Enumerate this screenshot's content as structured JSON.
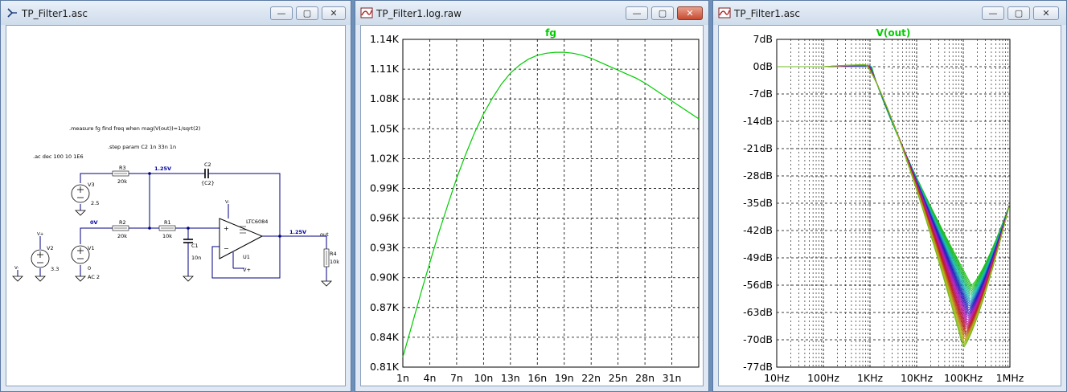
{
  "windows": {
    "schematic": {
      "title": "TP_Filter1.asc",
      "directives": [
        ".measure fg find freq when mag(V(out))=1/sqrt(2)",
        ".step param C2 1n 33n 1n",
        ".ac dec 100 10 1E6"
      ],
      "components": {
        "R3": {
          "name": "R3",
          "value": "20k"
        },
        "R2": {
          "name": "R2",
          "value": "20k"
        },
        "R1": {
          "name": "R1",
          "value": "10k"
        },
        "R4": {
          "name": "R4",
          "value": "10k"
        },
        "C1": {
          "name": "C1",
          "value": "10n"
        },
        "C2": {
          "name": "C2",
          "value": "{C2}"
        },
        "V1": {
          "name": "V1",
          "value": "0",
          "ac": "AC 2"
        },
        "V2": {
          "name": "V2",
          "value": "3.3"
        },
        "V3": {
          "name": "V3",
          "value": "2.5"
        },
        "U1": {
          "name": "U1",
          "part": "LTC6084"
        }
      },
      "node_labels": {
        "n125a": "1.25V",
        "n0v": "0V",
        "n125b": "1.25V",
        "out": "out",
        "vplus": "V+",
        "vminus": "V-",
        "vplus_small": "V+",
        "vminus_small": "V-"
      }
    },
    "fg_plot": {
      "title": "TP_Filter1.log.raw"
    },
    "bode_plot": {
      "title": "TP_Filter1.asc"
    }
  },
  "titlebar_buttons": {
    "minimize": "—",
    "maximize": "▢",
    "close": "✕"
  },
  "colors": {
    "trace_green": "#00cc00",
    "node_blue": "#0000a0",
    "wire_blue": "#000080"
  },
  "chart_data": [
    {
      "type": "line",
      "title": "fg",
      "x_ticks": [
        "1n",
        "4n",
        "7n",
        "10n",
        "13n",
        "16n",
        "19n",
        "22n",
        "25n",
        "28n",
        "31n"
      ],
      "y_ticks": [
        "1.14K",
        "1.11K",
        "1.08K",
        "1.05K",
        "1.02K",
        "0.99K",
        "0.96K",
        "0.93K",
        "0.90K",
        "0.87K",
        "0.84K",
        "0.81K"
      ],
      "xlim": [
        1,
        34
      ],
      "ylim": [
        810,
        1140
      ],
      "grid": true,
      "series": [
        {
          "x": [
            1,
            2,
            3,
            4,
            5,
            6,
            7,
            8,
            9,
            10,
            11,
            12,
            13,
            14,
            15,
            16,
            17,
            18,
            19,
            20,
            21,
            22,
            23,
            24,
            25,
            26,
            27,
            28,
            29,
            30,
            31,
            32,
            33,
            34
          ],
          "y": [
            820,
            852,
            884,
            915,
            945,
            973,
            1000,
            1024,
            1046,
            1065,
            1081,
            1095,
            1106,
            1114,
            1120,
            1124,
            1126,
            1127,
            1127,
            1126,
            1124,
            1121,
            1117,
            1113,
            1109,
            1105,
            1101,
            1096,
            1090,
            1084,
            1078,
            1072,
            1066,
            1060
          ]
        }
      ]
    },
    {
      "type": "line",
      "title": "V(out)",
      "x_ticks": [
        "10Hz",
        "100Hz",
        "1KHz",
        "10KHz",
        "100KHz",
        "1MHz"
      ],
      "y_ticks": [
        "7dB",
        "0dB",
        "-7dB",
        "-14dB",
        "-21dB",
        "-28dB",
        "-35dB",
        "-42dB",
        "-49dB",
        "-56dB",
        "-63dB",
        "-70dB",
        "-77dB"
      ],
      "xscale": "log",
      "xlim": [
        10,
        1000000
      ],
      "ylim": [
        -77,
        7
      ],
      "grid": true,
      "series_count": 33,
      "series_parameter": "C2 1n to 33n",
      "envelope": {
        "upper_min_db": -56,
        "upper_min_freq_hz": 150000,
        "lower_min_db": -72,
        "lower_min_freq_hz": 100000,
        "peak_db": 0.5,
        "peak_freq_hz": 1100,
        "end_db": -35
      }
    }
  ]
}
